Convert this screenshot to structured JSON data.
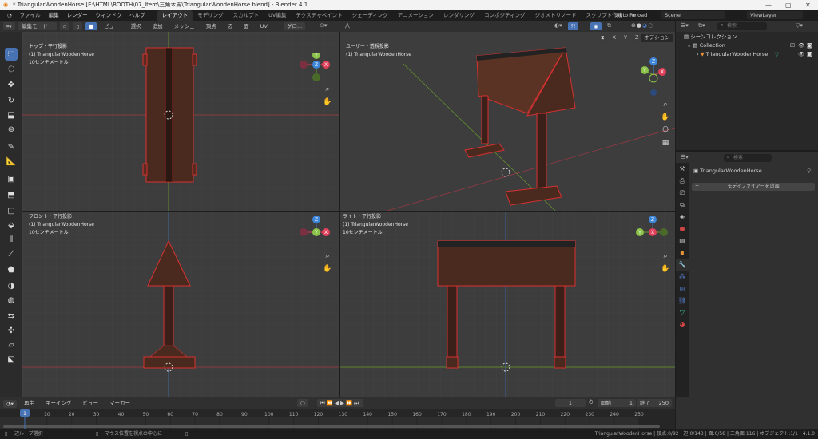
{
  "window": {
    "title": "* TriangularWoodenHorse [E:\\HTML\\BOOTH\\07_Item\\三角木馬\\TriangularWoodenHorse.blend] - Blender 4.1",
    "minimize": "—",
    "maximize": "▢",
    "close": "✕"
  },
  "menu": [
    "ファイル",
    "編集",
    "レンダー",
    "ウィンドウ",
    "ヘルプ"
  ],
  "workspaces": [
    "レイアウト",
    "モデリング",
    "スカルプト",
    "UV編集",
    "テクスチャペイント",
    "シェーディング",
    "アニメーション",
    "レンダリング",
    "コンポジティング",
    "ジオメトリノード",
    "スクリプト作成",
    "+"
  ],
  "topright": {
    "auto_reload": "Auto Reload",
    "scene": "Scene",
    "view_layer": "ViewLayer"
  },
  "viewport_header": {
    "mode": "編集モード",
    "menus": [
      "ビュー",
      "選択",
      "追加",
      "メッシュ",
      "頂点",
      "辺",
      "面",
      "UV"
    ],
    "transform": "グロ...",
    "options": "オプション",
    "axes": [
      "X",
      "Y",
      "Z"
    ]
  },
  "viewports": [
    {
      "title": "トップ・平行投影",
      "object": "(1) TriangularWoodenHorse",
      "scale": "10センチメートル"
    },
    {
      "title": "ユーザー・透視投影",
      "object": "(1) TriangularWoodenHorse"
    },
    {
      "title": "フロント・平行投影",
      "object": "(1) TriangularWoodenHorse",
      "scale": "10センチメートル"
    },
    {
      "title": "ライト・平行投影",
      "object": "(1) TriangularWoodenHorse",
      "scale": "10センチメートル"
    }
  ],
  "outliner": {
    "search_placeholder": "検索",
    "scene_collection": "シーンコレクション",
    "collection": "Collection",
    "object": "TriangularWoodenHorse"
  },
  "properties": {
    "search_placeholder": "検索",
    "object": "TriangularWoodenHorse",
    "add_modifier": "モディファイアーを追加"
  },
  "timeline": {
    "menus": [
      "再生",
      "キーイング",
      "ビュー",
      "マーカー"
    ],
    "current_frame": "1",
    "start_label": "開始",
    "start": "1",
    "end_label": "終了",
    "end": "250",
    "ticks": [
      "10",
      "20",
      "30",
      "40",
      "50",
      "60",
      "70",
      "80",
      "90",
      "100",
      "110",
      "120",
      "130",
      "140",
      "150",
      "160",
      "170",
      "180",
      "190",
      "200",
      "210",
      "220",
      "230",
      "240",
      "250"
    ],
    "playhead": "1"
  },
  "status": {
    "left": "辺ループ選択",
    "middle": "マウス位置を視点の中心に",
    "right": "TriangularWoodenHorse | 頂点:0/92 | 辺:0/143 | 面:0/58 | 三角面:116 | オブジェクト:1/1 | 4.1.0"
  },
  "colors": {
    "accent": "#4772b3",
    "select": "#e03030",
    "wood": "#4a2a1e",
    "x_axis": "#e0405a",
    "y_axis": "#8bc34a",
    "z_axis": "#3d86d9"
  }
}
